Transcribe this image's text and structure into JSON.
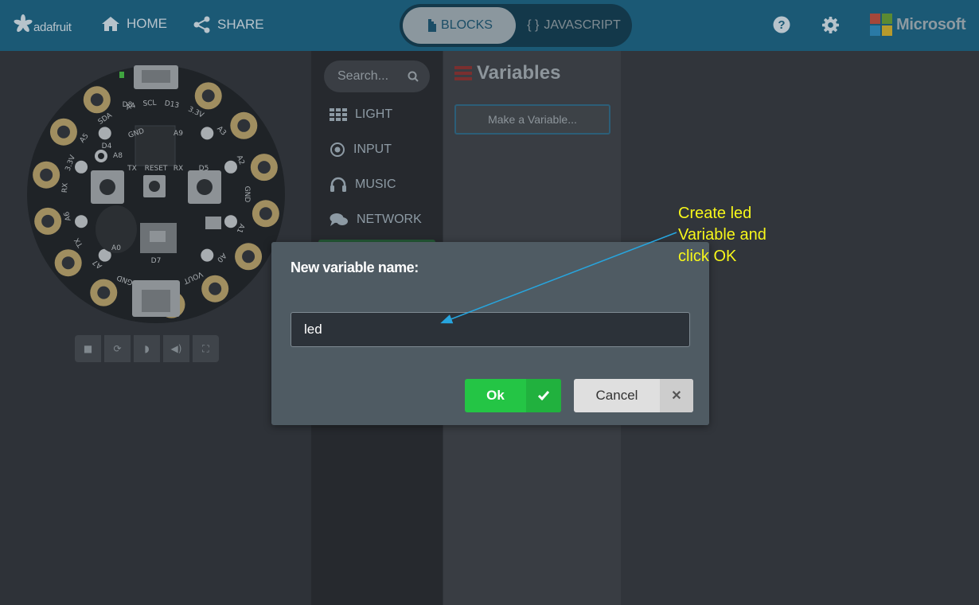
{
  "header": {
    "logo_text": "adafruit",
    "home_label": "HOME",
    "share_label": "SHARE",
    "blocks_label": "BLOCKS",
    "javascript_label": "JAVASCRIPT",
    "brand_label": "Microsoft"
  },
  "simulator": {
    "pin_labels": [
      "D13",
      "3.3V",
      "A3",
      "A2",
      "GND",
      "A1",
      "A0",
      "VOUT",
      "GND",
      "A7",
      "TX",
      "A6",
      "RX",
      "3.3V",
      "A5",
      "SDA",
      "A4",
      "SCL",
      "GND",
      "D8",
      "A8",
      "A9",
      "D4",
      "D5",
      "TX",
      "RESET",
      "RX",
      "A0",
      "D7"
    ],
    "board_colors": {
      "pcb": "#1f2327",
      "pad": "#a08e60",
      "silk": "#a8adb1"
    }
  },
  "toolbox": {
    "search_placeholder": "Search...",
    "categories": [
      {
        "label": "LIGHT",
        "color": "#2b4f77",
        "icon": "grid-icon"
      },
      {
        "label": "INPUT",
        "color": "#6b3169",
        "icon": "target-icon"
      },
      {
        "label": "MUSIC",
        "color": "#76402f",
        "icon": "headphones-icon"
      },
      {
        "label": "NETWORK",
        "color": "#6d2244",
        "icon": "chat-icon"
      }
    ]
  },
  "flyout": {
    "title": "Variables",
    "make_variable_label": "Make a Variable..."
  },
  "dialog": {
    "title": "New variable name:",
    "input_value": "led",
    "ok_label": "Ok",
    "cancel_label": "Cancel"
  },
  "annotation": {
    "line1": "Create led",
    "line2": "Variable and",
    "line3": "click OK",
    "color": "#f7f71a",
    "arrow_color": "#27a5de"
  }
}
